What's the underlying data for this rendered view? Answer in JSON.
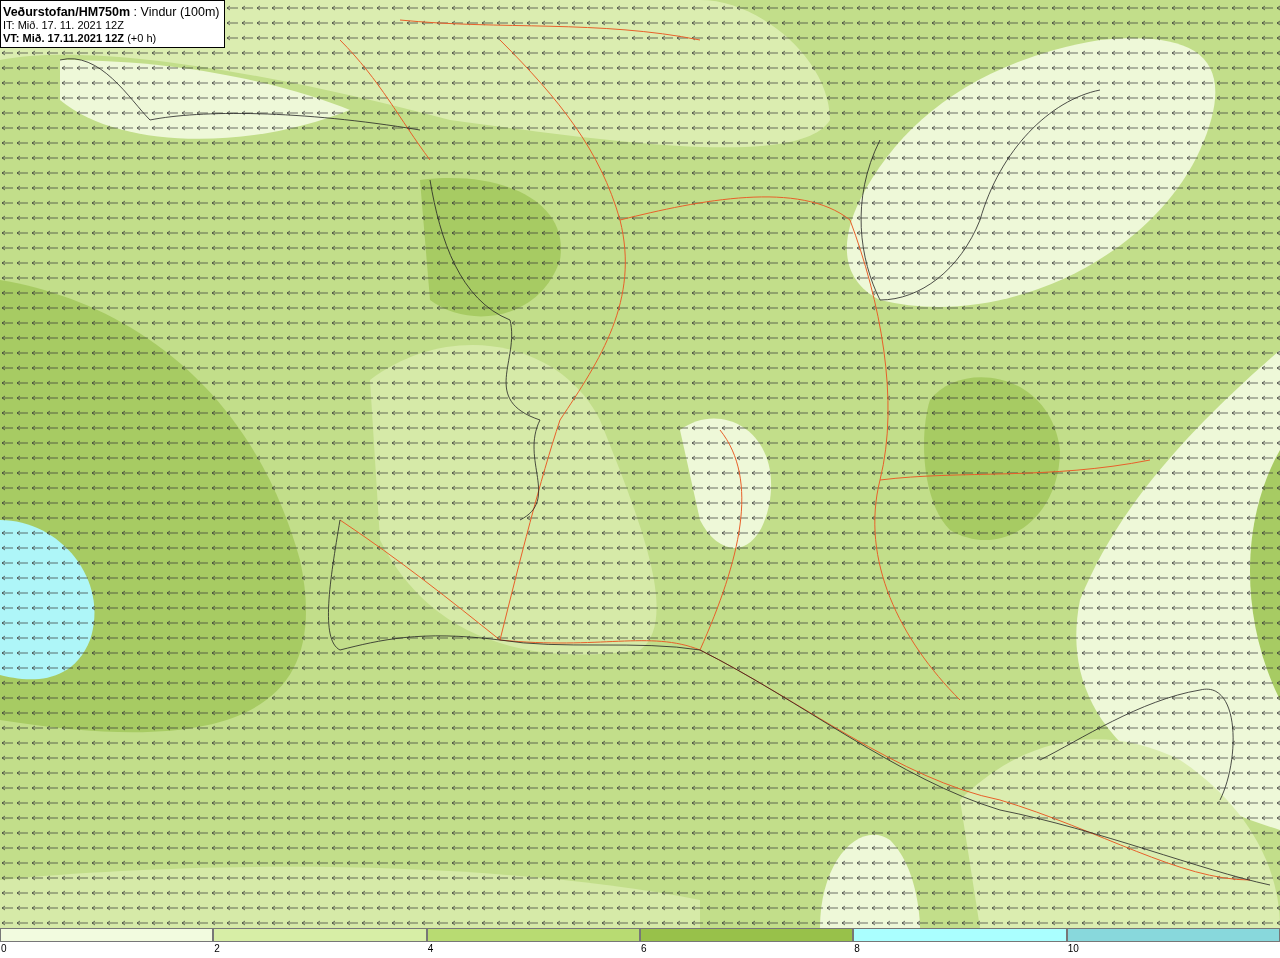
{
  "header": {
    "lines": [
      "**Veðurstofan/HM750m** : Vindur (100m)",
      "IT: Mið. 17. 11. 2021 12Z",
      "**VT: Mið. 17.11.2021 12Z** (+0 h)"
    ]
  },
  "legend": [
    {
      "label": "0",
      "color": "#f2fbdf"
    },
    {
      "label": "2",
      "color": "#d7eea6"
    },
    {
      "label": "4",
      "color": "#b8db72"
    },
    {
      "label": "6",
      "color": "#98c14a"
    },
    {
      "label": "8",
      "color": "#aaffff"
    },
    {
      "label": "10",
      "color": "#88d8dc"
    }
  ]
}
